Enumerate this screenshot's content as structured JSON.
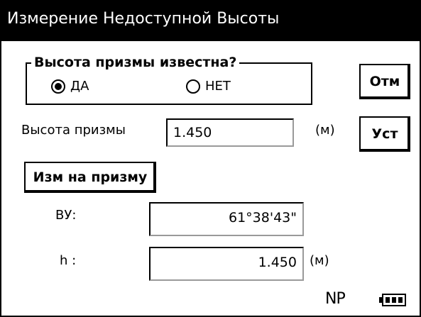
{
  "window": {
    "title": "Измерение Недоступной Высоты"
  },
  "prism_known": {
    "legend": "Высота призмы известна?",
    "options": [
      {
        "label": "ДА",
        "selected": true
      },
      {
        "label": "НЕТ",
        "selected": false
      }
    ]
  },
  "buttons": {
    "cancel": "Отм",
    "set": "Уст",
    "measure_prism": "Изм на призму"
  },
  "prism_height": {
    "label": "Высота призмы",
    "value": "1.450",
    "unit": "(м)"
  },
  "vertical_angle": {
    "label": "ВУ:",
    "value": "61°38'43\""
  },
  "height": {
    "label": "h :",
    "value": "1.450",
    "unit": "(м)"
  },
  "status": {
    "mode": "NP",
    "battery_level": 1.0
  }
}
